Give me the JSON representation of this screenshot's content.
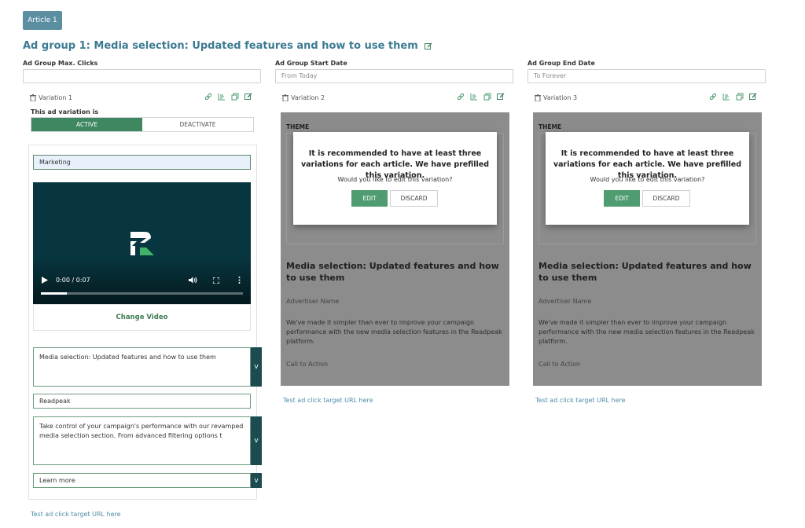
{
  "article_tab": "Article 1",
  "ad_group": {
    "title": "Ad group 1: Media selection: Updated features and how to use them",
    "max_clicks_label": "Ad Group Max. Clicks",
    "max_clicks_value": "",
    "start_date_label": "Ad Group Start Date",
    "start_date_placeholder": "From Today",
    "end_date_label": "Ad Group End Date",
    "end_date_placeholder": "To Forever"
  },
  "variation1": {
    "label": "Variation 1",
    "status_label": "This ad variation is",
    "active_label": "ACTIVE",
    "deactivate_label": "DEACTIVATE",
    "theme_value": "Marketing",
    "video_time": "0:00 / 0:07",
    "video_progress": 0.13,
    "change_video": "Change Video",
    "headline": "Media selection: Updated features and how to use them",
    "advertiser": "Readpeak",
    "body": "Take control of your campaign's performance with our revamped media selection section. From advanced filtering options t",
    "cta": "Learn more",
    "expand_glyph": "v",
    "test_link": "Test ad click target URL here"
  },
  "variation2": {
    "label": "Variation 2",
    "theme": "THEME",
    "modal_title": "It is recommended to have at least three variations for each article. We have prefilled this variation.",
    "modal_question": "Would you like to edit this variation?",
    "edit_label": "EDIT",
    "discard_label": "DISCARD",
    "ad_title": "Media selection: Updated features and how to use them",
    "advertiser": "Advertiser Name",
    "body": "We've made it simpler than ever to improve your campaign performance with the new media selection features in the Readpeak platform.",
    "cta": "Call to Action",
    "test_link": "Test ad click target URL here"
  },
  "variation3": {
    "label": "Variation 3",
    "theme": "THEME",
    "modal_title": "It is recommended to have at least three variations for each article. We have prefilled this variation.",
    "modal_question": "Would you like to edit this variation?",
    "edit_label": "EDIT",
    "discard_label": "DISCARD",
    "ad_title": "Media selection: Updated features and how to use them",
    "advertiser": "Advertiser Name",
    "body": "We've made it simpler than ever to improve your campaign performance with the new media selection features in the Readpeak platform.",
    "cta": "Call to Action",
    "test_link": "Test ad click target URL here"
  },
  "colors": {
    "accent_green": "#3f8760",
    "title_blue": "#3d7b92",
    "tab_blue": "#5a8ea0",
    "overlay_gray": "#8c8c8c"
  }
}
